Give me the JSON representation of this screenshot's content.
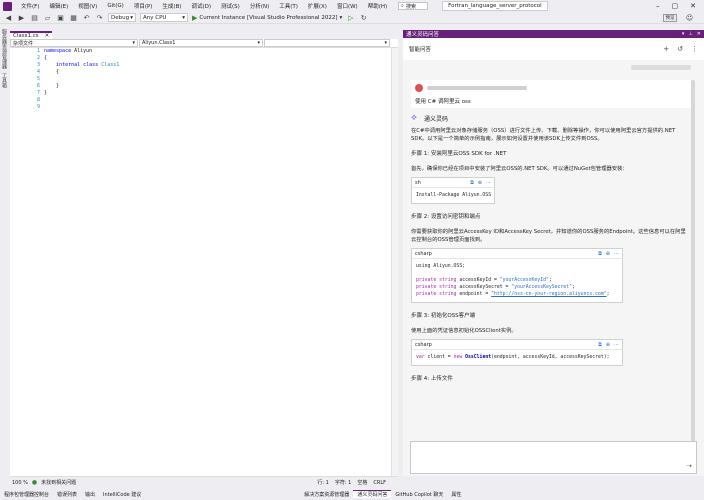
{
  "menubar": {
    "items": [
      "文件(F)",
      "编辑(E)",
      "视图(V)",
      "Git(G)",
      "项目(P)",
      "生成(B)",
      "调试(D)",
      "测试(S)",
      "分析(N)",
      "工具(T)",
      "扩展(X)",
      "窗口(W)",
      "帮助(H)"
    ],
    "search": "搜索",
    "solution_title": "Fortran_language_server_protocol"
  },
  "toolbar": {
    "config": "Debug",
    "platform": "Any CPU",
    "start_label": "Current Instance [Visual Studio Professional 2022]",
    "preview_label": "预览"
  },
  "left_strip": {
    "tabs": [
      "服务器资源管理器",
      "工具箱"
    ]
  },
  "editor": {
    "tab_name": "Class1.cs",
    "nav": {
      "project": "杂项文件",
      "member": "Aliyun.Class1",
      "third": ""
    },
    "line_numbers": [
      "1",
      "2",
      "3",
      "4",
      "5",
      "6",
      "7",
      "8",
      "9"
    ],
    "code": {
      "l1_kw": "namespace",
      "l1_name": " Aliyun",
      "l2": "{",
      "l3_kw": "internal class",
      "l3_ty": " Class1",
      "l4": "{",
      "l6": "}",
      "l7": "}"
    },
    "status": {
      "zoom": "100 %",
      "issues": "未找到相关问题",
      "line": "行: 1",
      "char": "字符: 1",
      "spc": "空格",
      "crlf": "CRLF"
    }
  },
  "bottom_tabs": {
    "left": [
      "程序包管理器控制台",
      "错误列表",
      "输出",
      "IntelliCode 建议"
    ],
    "right": [
      "解决方案资源管理器",
      "通义灵码问答",
      "GitHub Copilot 聊天",
      "属性"
    ],
    "active": "通义灵码问答"
  },
  "right_panel": {
    "title": "通义灵码问答",
    "header": "智能问答",
    "user_question": "使用 C# 调阿里云 oss",
    "assistant_name": "通义灵码",
    "intro": "在C#中调用阿里云对象存储服务（OSS）进行文件上传、下载、删除等操作，你可以使用阿里云官方提供的.NET SDK。以下是一个简单的示例指南，展示如何设置并使用该SDK上传文件到OSS。",
    "step1": "步骤 1: 安装阿里云OSS SDK for .NET",
    "step1_text": "首先，确保你已经在项目中安装了阿里云OSS的.NET SDK。可以通过NuGet包管理器安装：",
    "code1_lang": "sh",
    "code1": "Install-Package Aliyun.OSS",
    "step2": "步骤 2: 设置访问密钥和端点",
    "step2_text": "你需要获取你的阿里云AccessKey ID和AccessKey Secret，并知道你的OSS服务的Endpoint。这些信息可以在阿里云控制台的OSS管理页面找到。",
    "code2_lang": "csharp",
    "code2": {
      "using": "using Aliyun.OSS;",
      "kw": "private string",
      "v1": " accessKeyId = ",
      "s1": "\"yourAccessKeyId\"",
      "v2": " accessKeySecret = ",
      "s2": "\"yourAccessKeySecret\"",
      "v3": " endpoint = ",
      "s3": "\"http://oss-cn-your-region.aliyuncs.com\"",
      "end": ";"
    },
    "step3": "步骤 3: 初始化OSS客户端",
    "step3_text": "使用上面的凭证信息初始化OSSClient实例。",
    "code3_lang": "csharp",
    "code3": {
      "kw": "var",
      "a": " client = ",
      "new": "new",
      "fn": " OssClient",
      "b": "(endpoint, accessKeyId, accessKeySecret);"
    },
    "step4": "步骤 4: 上传文件"
  },
  "colors": {
    "accent": "#68217a",
    "keyword": "#0000ff",
    "type": "#2b91af"
  }
}
